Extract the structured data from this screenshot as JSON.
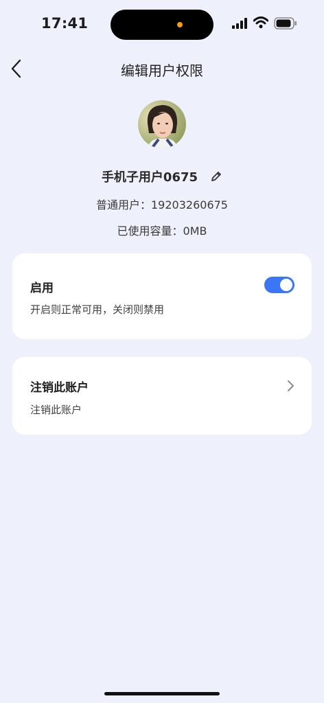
{
  "status_bar": {
    "time": "17:41",
    "icons": [
      "signal-icon",
      "wifi-icon",
      "battery-icon"
    ],
    "island_dot_color": "#f39a1a"
  },
  "nav": {
    "title": "编辑用户权限",
    "back_icon": "back-icon"
  },
  "profile": {
    "name": "手机子用户0675",
    "edit_icon": "pencil-icon",
    "phone_label": "普通用户：19203260675",
    "storage_label": "已使用容量：0MB"
  },
  "enable_card": {
    "title": "启用",
    "description": "开启则正常可用，关闭则禁用",
    "toggle_on": true,
    "toggle_color": "#3b76f6"
  },
  "deregister_card": {
    "title": "注销此账户",
    "description": "注销此账户",
    "chevron_icon": "chevron-right-icon"
  },
  "colors": {
    "background": "#eef1fb",
    "card": "#ffffff",
    "accent": "#3b76f6"
  }
}
